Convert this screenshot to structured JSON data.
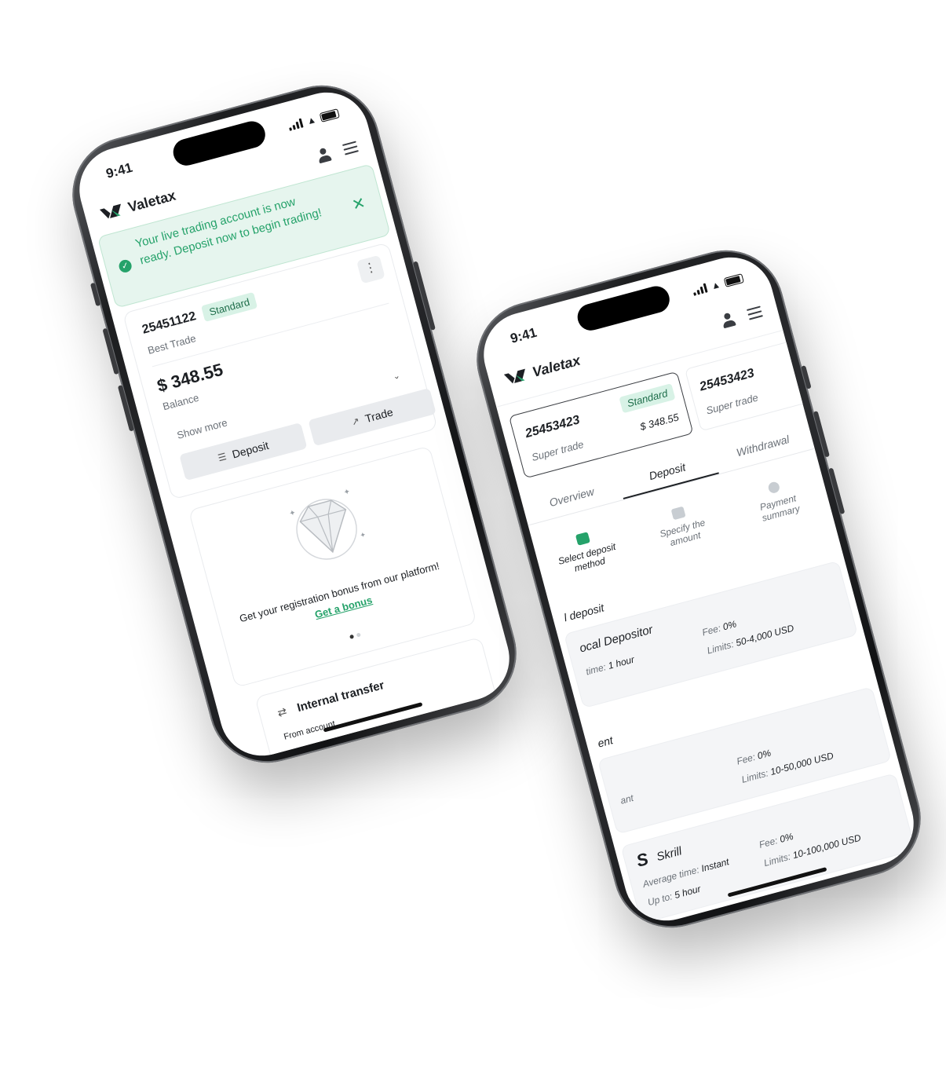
{
  "left_phone": {
    "status_time": "9:41",
    "brand": "Valetax",
    "alert_text": "Your live trading account is now ready. Deposit now to begin trading!",
    "account": {
      "number": "25451122",
      "badge": "Standard",
      "type": "Best Trade",
      "balance": "$ 348.55",
      "balance_label": "Balance",
      "show_more": "Show more",
      "deposit_label": "Deposit",
      "trade_label": "Trade"
    },
    "promo": {
      "text": "Get your registration bonus from our platform!",
      "link": "Get a bonus"
    },
    "transfer": {
      "title": "Internal transfer",
      "from_label": "From account"
    }
  },
  "right_phone": {
    "status_time": "9:41",
    "brand": "Valetax",
    "accounts": [
      {
        "number": "25453423",
        "badge": "Standard",
        "type": "Super trade",
        "balance": "$ 348.55"
      },
      {
        "number": "25453423",
        "type": "Super trade"
      }
    ],
    "tabs": [
      "Overview",
      "Deposit",
      "Withdrawal"
    ],
    "active_tab": "Deposit",
    "steps": [
      "Select deposit method",
      "Specify the amount",
      "Payment summary"
    ],
    "section_1_title": "l deposit",
    "methods": [
      {
        "name": "ocal Depositor",
        "time_label": "time:",
        "time": "1 hour",
        "fee_label": "Fee:",
        "fee": "0%",
        "limits_label": "Limits:",
        "limits": "50-4,000 USD"
      },
      {
        "name": "",
        "time_label": "ant",
        "time": "",
        "fee_label": "Fee:",
        "fee": "0%",
        "limits_label": "Limits:",
        "limits": "10-50,000 USD"
      },
      {
        "name": "Skrill",
        "time_label": "Average time:",
        "time": "Instant",
        "upto_label": "Up to:",
        "upto": "5 hour",
        "fee_label": "Fee:",
        "fee": "0%",
        "limits_label": "Limits:",
        "limits": "10-100,000 USD"
      }
    ],
    "section_2_title": "ent"
  },
  "colors": {
    "accent": "#25a26a",
    "alert_bg": "#e6f5ee",
    "badge_bg": "#d8f2e6"
  }
}
